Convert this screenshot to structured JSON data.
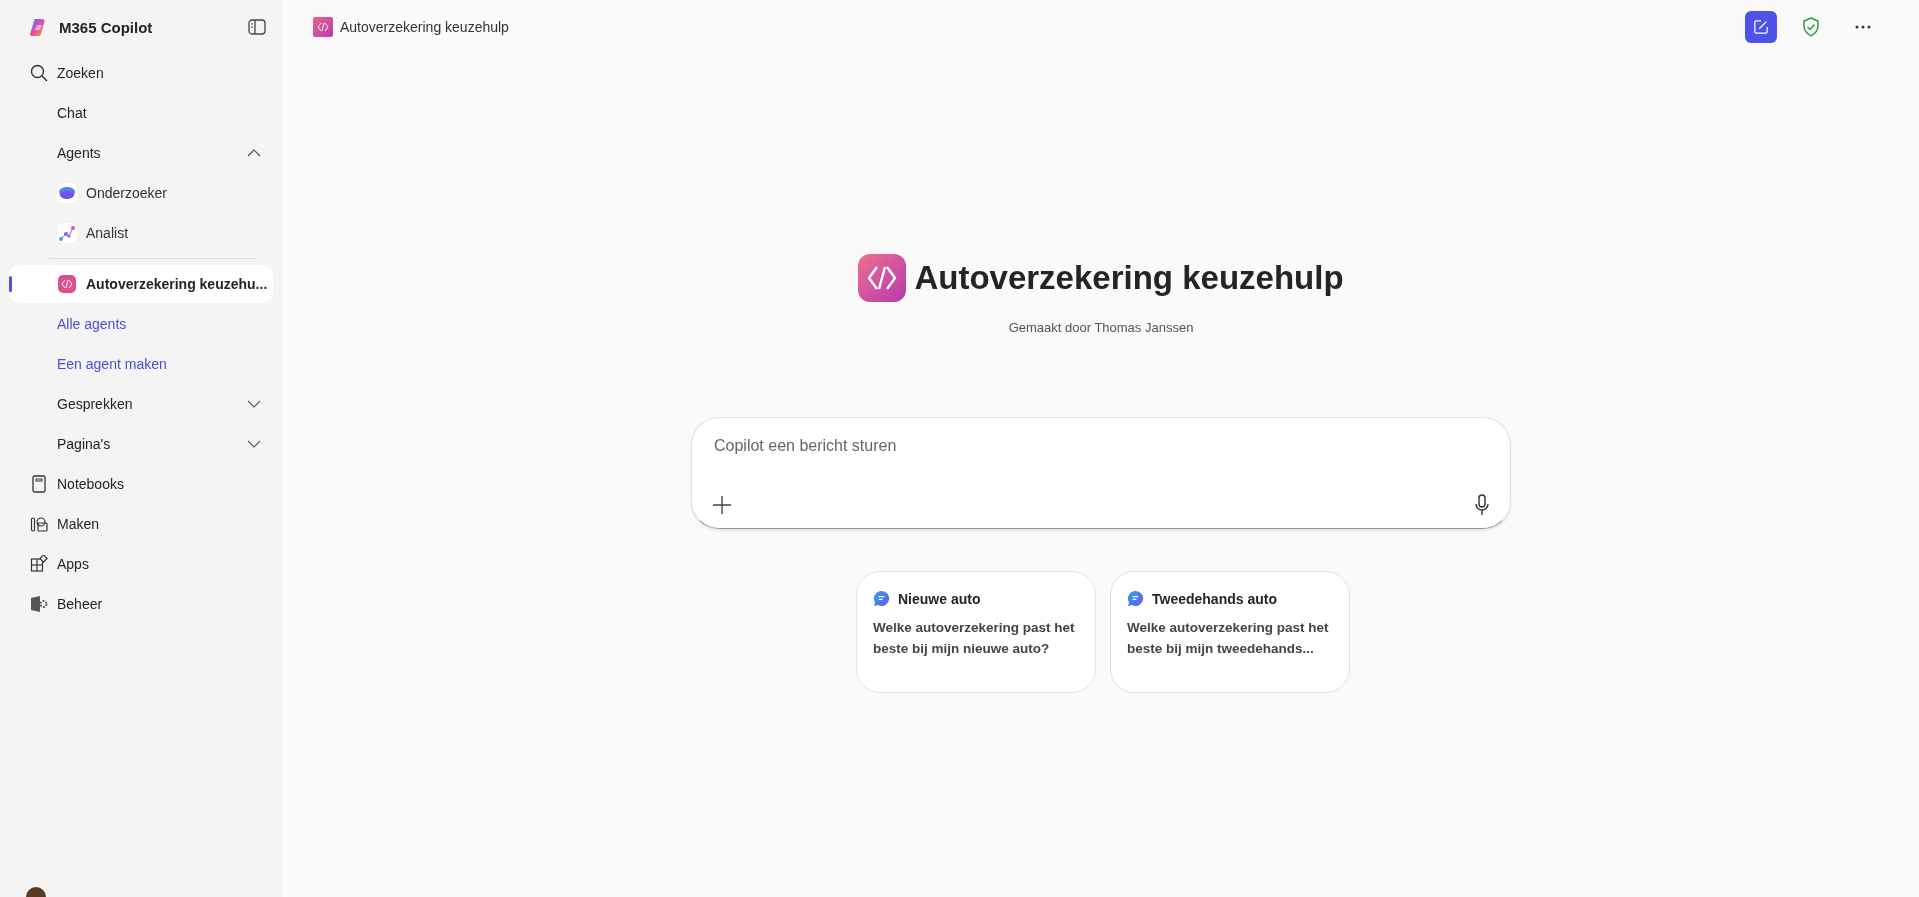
{
  "app": {
    "title": "M365 Copilot"
  },
  "sidebar": {
    "items": [
      {
        "kind": "nav",
        "label": "Zoeken"
      },
      {
        "kind": "sub",
        "label": "Chat"
      },
      {
        "kind": "section",
        "label": "Agents",
        "expanded": true,
        "children": [
          {
            "kind": "agent",
            "label": "Onderzoeker",
            "selected": false
          },
          {
            "kind": "agent",
            "label": "Analist",
            "selected": false
          },
          {
            "kind": "divider"
          },
          {
            "kind": "agent",
            "label": "Autoverzekering keuzehu...",
            "selected": true
          },
          {
            "kind": "link",
            "label": "Alle agents"
          },
          {
            "kind": "link",
            "label": "Een agent maken"
          }
        ]
      },
      {
        "kind": "section",
        "label": "Gesprekken",
        "expanded": false
      },
      {
        "kind": "section",
        "label": "Pagina's",
        "expanded": false
      },
      {
        "kind": "nav",
        "label": "Notebooks"
      },
      {
        "kind": "nav",
        "label": "Maken"
      },
      {
        "kind": "nav",
        "label": "Apps"
      },
      {
        "kind": "nav",
        "label": "Beheer"
      }
    ]
  },
  "header": {
    "title": "Autoverzekering keuzehulp"
  },
  "hero": {
    "title": "Autoverzekering keuzehulp",
    "subtitle": "Gemaakt door Thomas Janssen"
  },
  "composer": {
    "placeholder": "Copilot een bericht sturen"
  },
  "suggestions": [
    {
      "title": "Nieuwe auto",
      "text": "Welke autoverzekering past het beste bij mijn nieuwe auto?"
    },
    {
      "title": "Tweedehands auto",
      "text": "Welke autoverzekering past het beste bij mijn tweedehands..."
    }
  ]
}
